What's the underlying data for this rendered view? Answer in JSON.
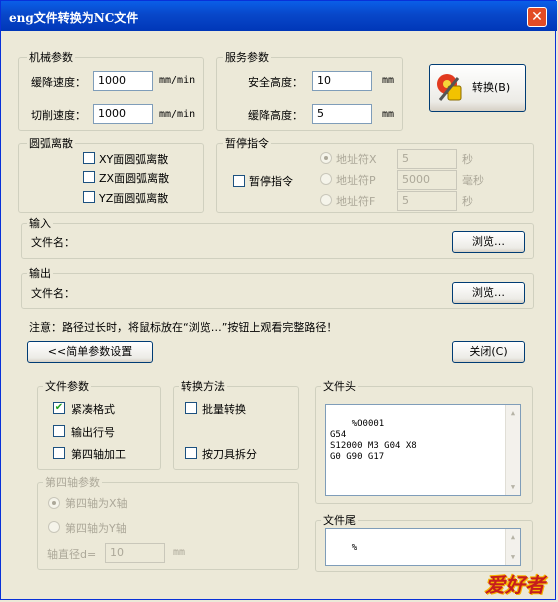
{
  "window": {
    "title": "eng文件转换为NC文件",
    "close": "✕"
  },
  "mech": {
    "title": "机械参数",
    "feed_down_label": "缓降速度：",
    "feed_down_value": "1000",
    "feed_down_unit": "mm/min",
    "cut_label": "切削速度：",
    "cut_value": "1000",
    "cut_unit": "mm/min"
  },
  "service": {
    "title": "服务参数",
    "safe_label": "安全高度：",
    "safe_value": "10",
    "safe_unit": "mm",
    "down_label": "缓降高度：",
    "down_value": "5",
    "down_unit": "mm"
  },
  "convert_button": "转换(B)",
  "arc": {
    "title": "圆弧离散",
    "items": [
      {
        "label": "XY面圆弧离散",
        "checked": false
      },
      {
        "label": "ZX面圆弧离散",
        "checked": false
      },
      {
        "label": "YZ面圆弧离散",
        "checked": false
      }
    ]
  },
  "pause": {
    "title": "暂停指令",
    "check_label": "暂停指令",
    "rows": [
      {
        "label": "地址符X",
        "value": "5",
        "unit": "秒"
      },
      {
        "label": "地址符P",
        "value": "5000",
        "unit": "毫秒"
      },
      {
        "label": "地址符F",
        "value": "5",
        "unit": "秒"
      }
    ]
  },
  "input": {
    "title": "输入",
    "file_label": "文件名：",
    "browse": "浏览…"
  },
  "output": {
    "title": "输出",
    "file_label": "文件名：",
    "browse": "浏览…"
  },
  "note": "注意：路径过长时，将鼠标放在“浏览…”按钮上观看完整路径！",
  "simple_button": "<<简单参数设置",
  "close_button": "关闭(C)",
  "file_params": {
    "title": "文件参数",
    "items": [
      {
        "label": "紧凑格式",
        "checked": true
      },
      {
        "label": "输出行号",
        "checked": false
      },
      {
        "label": "第四轴加工",
        "checked": false
      }
    ]
  },
  "convert_method": {
    "title": "转换方法",
    "items": [
      {
        "label": "批量转换",
        "checked": false
      },
      {
        "label": "按刀具拆分",
        "checked": false
      }
    ]
  },
  "file_head": {
    "title": "文件头",
    "text": "%O0001\nG54\nS12000 M3 G04 X8\nG0 G90 G17"
  },
  "fourth_axis": {
    "title": "第四轴参数",
    "opt_x": "第四轴为X轴",
    "opt_y": "第四轴为Y轴",
    "diam_label": "轴直径d=",
    "diam_value": "10",
    "diam_unit": "mm"
  },
  "file_tail": {
    "title": "文件尾",
    "text": "%"
  },
  "watermark": "爱好者"
}
